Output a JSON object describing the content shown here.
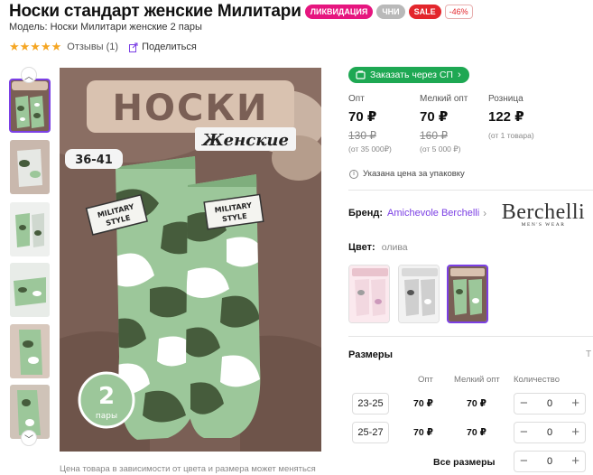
{
  "product": {
    "title": "Носки стандарт женские Милитари",
    "badges": [
      "ЛИКВИДАЦИЯ",
      "ЧНИ",
      "SALE",
      "-46%"
    ],
    "model": "Модель: Носки Милитари женские 2 пары",
    "stars": "★★★★★",
    "reviews": "Отзывы (1)",
    "share": "Поделиться"
  },
  "main_image": {
    "heading": "НОСКИ",
    "subheading": "Женские",
    "size_label": "36-41",
    "tag_line1": "MILITARY",
    "tag_line2": "STYLE",
    "pack_count": "2",
    "pack_unit": "пары"
  },
  "caption": "Цена товара в зависимости от цвета и размера может меняться",
  "order_button": "Заказать через СП",
  "prices": [
    {
      "label": "Опт",
      "price": "70 ₽",
      "old": "130 ₽",
      "note": "(от 35 000₽)"
    },
    {
      "label": "Мелкий опт",
      "price": "70 ₽",
      "old": "160 ₽",
      "note": "(от 5 000 ₽)"
    },
    {
      "label": "Розница",
      "price": "122 ₽",
      "old": "",
      "note": "(от 1 товара)"
    }
  ],
  "pack_note": "Указана цена за упаковку",
  "brand": {
    "label": "Бренд:",
    "name": "Amichevole Berchelli",
    "logo_big": "Berchelli",
    "logo_small": "MEN'S WEAR"
  },
  "color": {
    "label": "Цвет:",
    "value": "олива"
  },
  "sizes": {
    "title": "Размеры",
    "side_link": "Т",
    "headers": [
      "Опт",
      "Мелкий опт",
      "Количество"
    ],
    "rows": [
      {
        "size": "23-25",
        "opt": "70 ₽",
        "small_opt": "70 ₽",
        "qty": "0"
      },
      {
        "size": "25-27",
        "opt": "70 ₽",
        "small_opt": "70 ₽",
        "qty": "0"
      }
    ],
    "all_label": "Все размеры",
    "all_qty": "0"
  },
  "colors_accent": {
    "purple": "#7b3fe4",
    "green": "#1ea853",
    "pink": "#e6157f",
    "red": "#e3262c",
    "star": "#f5a623"
  }
}
